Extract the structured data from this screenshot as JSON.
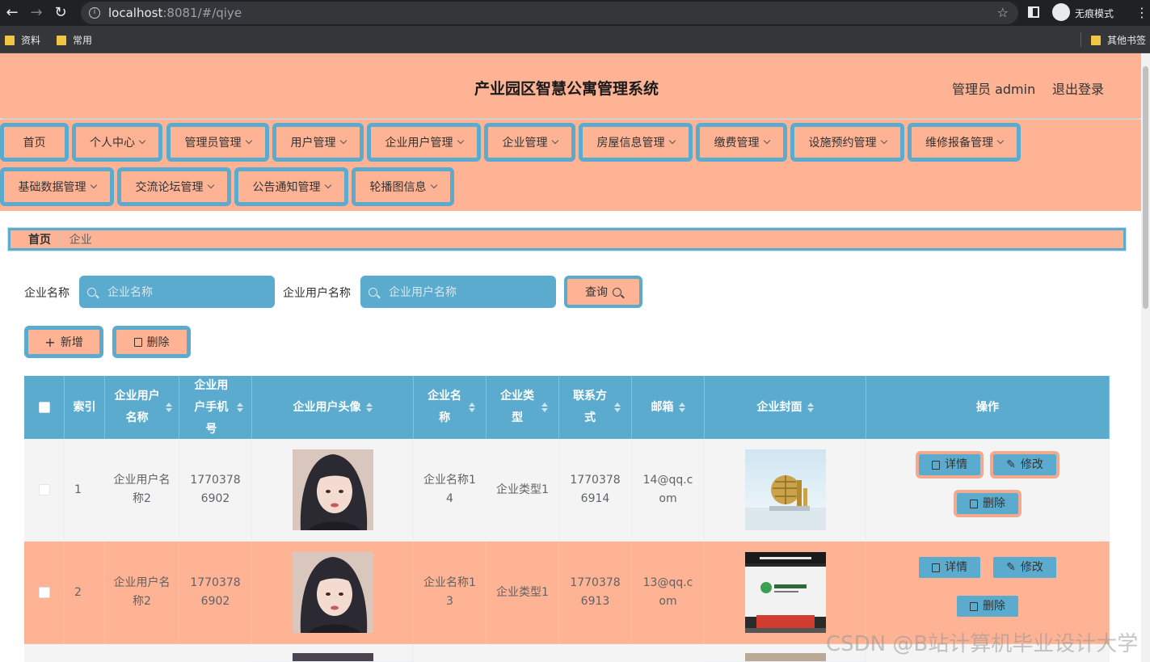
{
  "browser": {
    "url_host": "localhost",
    "url_path": ":8081/#/qiye",
    "incognito_label": "无痕模式",
    "bookmarks": [
      "资料",
      "常用"
    ],
    "other_bookmarks": "其他书签"
  },
  "header": {
    "title": "产业园区智慧公寓管理系统",
    "admin_label": "管理员 admin",
    "logout": "退出登录"
  },
  "menu": {
    "items": [
      "首页",
      "个人中心",
      "管理员管理",
      "用户管理",
      "企业用户管理",
      "企业管理",
      "房屋信息管理",
      "缴费管理",
      "设施预约管理",
      "维修报备管理",
      "基础数据管理",
      "交流论坛管理",
      "公告通知管理",
      "轮播图信息"
    ]
  },
  "breadcrumb": {
    "home": "首页",
    "current": "企业"
  },
  "search": {
    "company_name_label": "企业名称",
    "company_name_placeholder": "企业名称",
    "company_user_label": "企业用户名称",
    "company_user_placeholder": "企业用户名称",
    "query_button": "查询"
  },
  "actions": {
    "add": "新增",
    "delete": "删除"
  },
  "table": {
    "headers": {
      "index": "索引",
      "user_name": "企业用户名称",
      "user_phone": "企业用户手机号",
      "user_avatar": "企业用户头像",
      "company_name": "企业名称",
      "company_type": "企业类型",
      "contact": "联系方式",
      "email": "邮箱",
      "cover": "企业封面",
      "operations": "操作"
    },
    "rows": [
      {
        "index": "1",
        "user_name": "企业用户名称2",
        "user_phone": "17703786902",
        "company_name": "企业名称14",
        "company_type": "企业类型1",
        "contact": "17703786914",
        "email": "14@qq.com"
      },
      {
        "index": "2",
        "user_name": "企业用户名称2",
        "user_phone": "17703786902",
        "company_name": "企业名称13",
        "company_type": "企业类型1",
        "contact": "17703786913",
        "email": "13@qq.com"
      }
    ],
    "op_labels": {
      "detail": "详情",
      "edit": "修改",
      "delete": "删除"
    }
  },
  "watermark": "CSDN @B站计算机毕业设计大学",
  "colors": {
    "header_bg": "#feb395",
    "accent": "#5babce",
    "row_alt": "#feb395",
    "row_bg": "#f4f4f4"
  }
}
